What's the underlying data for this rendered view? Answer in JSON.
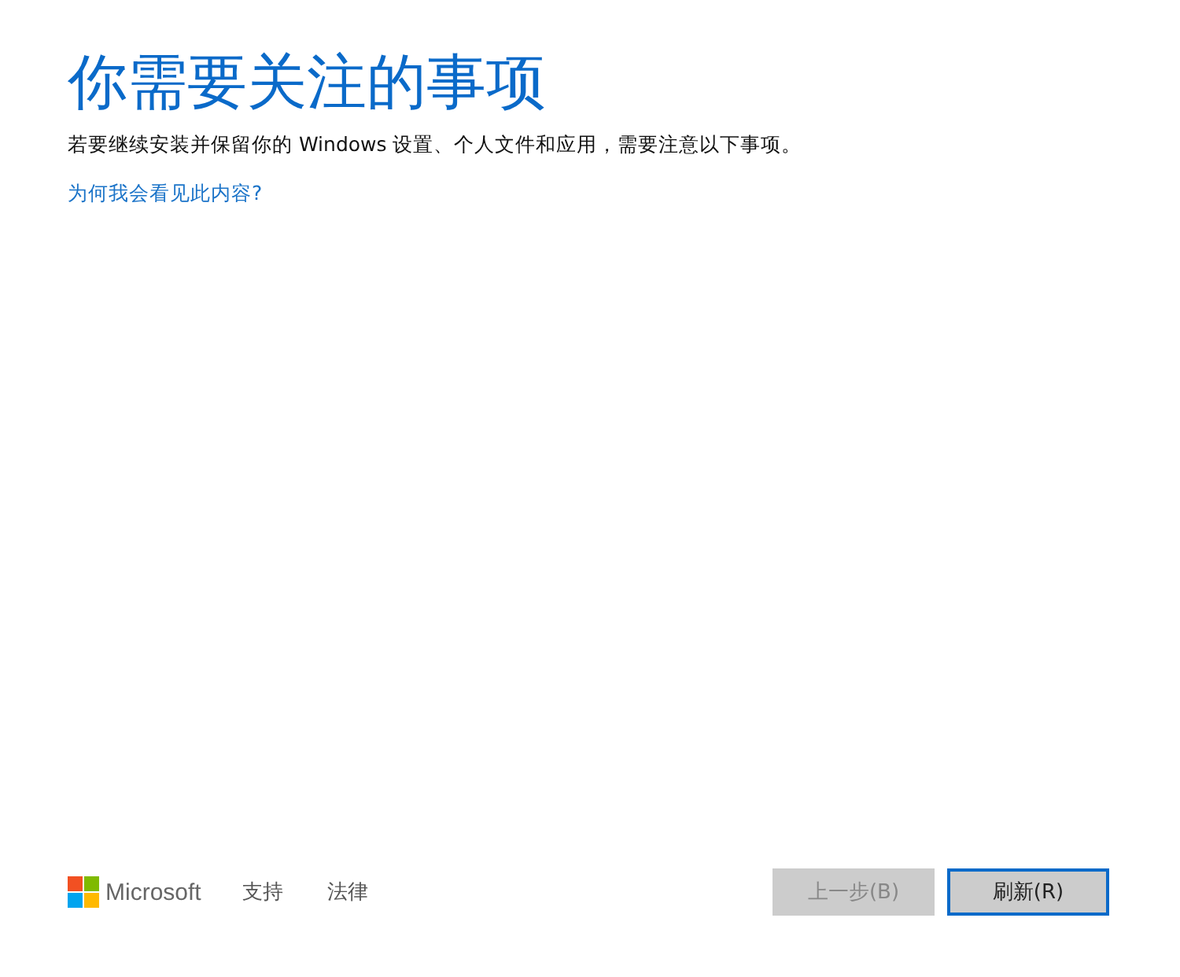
{
  "title": "你需要关注的事项",
  "description": "若要继续安装并保留你的 Windows 设置、个人文件和应用，需要注意以下事项。",
  "help_link": "为何我会看见此内容?",
  "footer": {
    "brand": "Microsoft",
    "links": [
      "支持",
      "法律"
    ]
  },
  "buttons": [
    {
      "label": "上一步(B)",
      "disabled": true,
      "selected": false
    },
    {
      "label": "刷新(R)",
      "disabled": false,
      "selected": true
    }
  ]
}
